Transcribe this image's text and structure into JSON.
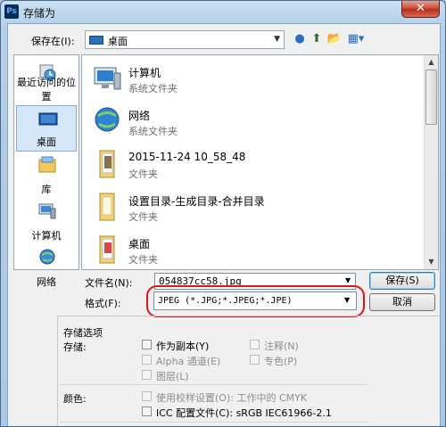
{
  "window": {
    "title": "存储为",
    "app_icon": "Ps",
    "close_glyph": "✕"
  },
  "lookin": {
    "label": "保存在(I):",
    "value": "桌面",
    "arrow": "▼"
  },
  "toolbar": {
    "back": "●",
    "up": "⬆",
    "new_folder": "📂",
    "views": "▦▾"
  },
  "places": [
    {
      "label": "最近访问的位置",
      "icon": "recent-places-icon"
    },
    {
      "label": "桌面",
      "icon": "desktop-icon",
      "selected": true
    },
    {
      "label": "库",
      "icon": "libraries-icon"
    },
    {
      "label": "计算机",
      "icon": "computer-icon"
    },
    {
      "label": "网络",
      "icon": "network-icon"
    }
  ],
  "files": [
    {
      "name": "计算机",
      "type": "系统文件夹",
      "icon": "computer-icon"
    },
    {
      "name": "网络",
      "type": "系统文件夹",
      "icon": "network-icon"
    },
    {
      "name": "2015-11-24 10_58_48",
      "type": "文件夹",
      "icon": "folder-icon"
    },
    {
      "name": "设置目录-生成目录-合并目录",
      "type": "文件夹",
      "icon": "folder-icon"
    },
    {
      "name": "桌面",
      "type": "文件夹",
      "icon": "folder-icon"
    }
  ],
  "scroll": {
    "up": "▲",
    "down": "▼"
  },
  "filename": {
    "label": "文件名(N):",
    "value": "054837cc58.jpg",
    "arrow": "▼"
  },
  "format": {
    "label": "格式(F):",
    "value": "JPEG (*.JPG;*.JPEG;*.JPE)",
    "arrow": "▼"
  },
  "buttons": {
    "save": "保存(S)",
    "cancel": "取消"
  },
  "options": {
    "section_title": "存储选项",
    "storage_label": "存储:",
    "as_copy": "作为副本(Y)",
    "annotations": "注释(N)",
    "alpha": "Alpha 通道(E)",
    "spot": "专色(P)",
    "layers": "图层(L)",
    "color_label": "颜色:",
    "use_proof": "使用校样设置(O):  工作中的 CMYK",
    "icc": "ICC 配置文件(C):  sRGB IEC61966-2.1"
  }
}
